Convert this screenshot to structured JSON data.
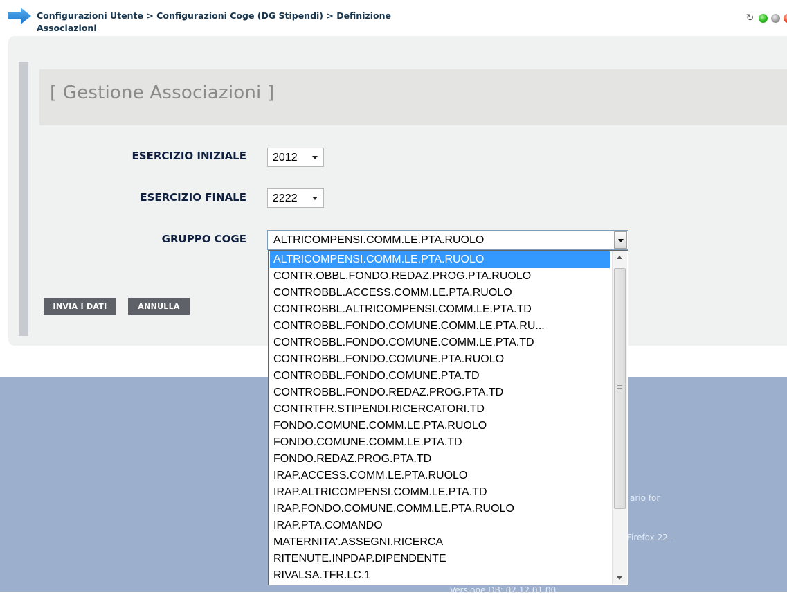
{
  "breadcrumb": {
    "line1": "Configurazioni Utente > Configurazioni Coge (DG Stipendi) > Definizione",
    "line2": "Associazioni"
  },
  "status_icons": [
    "refresh-icon",
    "green-status-icon",
    "gray-status-icon",
    "red-status-icon"
  ],
  "section_title": "[ Gestione Associazioni ]",
  "form": {
    "esercizio_iniziale": {
      "label": "ESERCIZIO INIZIALE",
      "value": "2012"
    },
    "esercizio_finale": {
      "label": "ESERCIZIO FINALE",
      "value": "2222"
    },
    "gruppo_coge": {
      "label": "GRUPPO COGE",
      "value": "ALTRICOMPENSI.COMM.LE.PTA.RUOLO"
    }
  },
  "buttons": {
    "invia": "INVIA I DATI",
    "annulla": "ANNULLA"
  },
  "footer_fragments": [
    "ario for",
    "Firefox 22 -",
    "Versione DB: 02.12.01.00"
  ],
  "dropdown": {
    "selected_index": 0,
    "options": [
      "ALTRICOMPENSI.COMM.LE.PTA.RUOLO",
      "CONTR.OBBL.FONDO.REDAZ.PROG.PTA.RUOLO",
      "CONTROBBL.ACCESS.COMM.LE.PTA.RUOLO",
      "CONTROBBL.ALTRICOMPENSI.COMM.LE.PTA.TD",
      "CONTROBBL.FONDO.COMUNE.COMM.LE.PTA.RU...",
      "CONTROBBL.FONDO.COMUNE.COMM.LE.PTA.TD",
      "CONTROBBL.FONDO.COMUNE.PTA.RUOLO",
      "CONTROBBL.FONDO.COMUNE.PTA.TD",
      "CONTROBBL.FONDO.REDAZ.PROG.PTA.TD",
      "CONTRTFR.STIPENDI.RICERCATORI.TD",
      "FONDO.COMUNE.COMM.LE.PTA.RUOLO",
      "FONDO.COMUNE.COMM.LE.PTA.TD",
      "FONDO.REDAZ.PROG.PTA.TD",
      "IRAP.ACCESS.COMM.LE.PTA.RUOLO",
      "IRAP.ALTRICOMPENSI.COMM.LE.PTA.TD",
      "IRAP.FONDO.COMUNE.COMM.LE.PTA.RUOLO",
      "IRAP.PTA.COMANDO",
      "MATERNITA'.ASSEGNI.RICERCA",
      "RITENUTE.INPDAP.DIPENDENTE",
      "RIVALSA.TFR.LC.1"
    ]
  }
}
